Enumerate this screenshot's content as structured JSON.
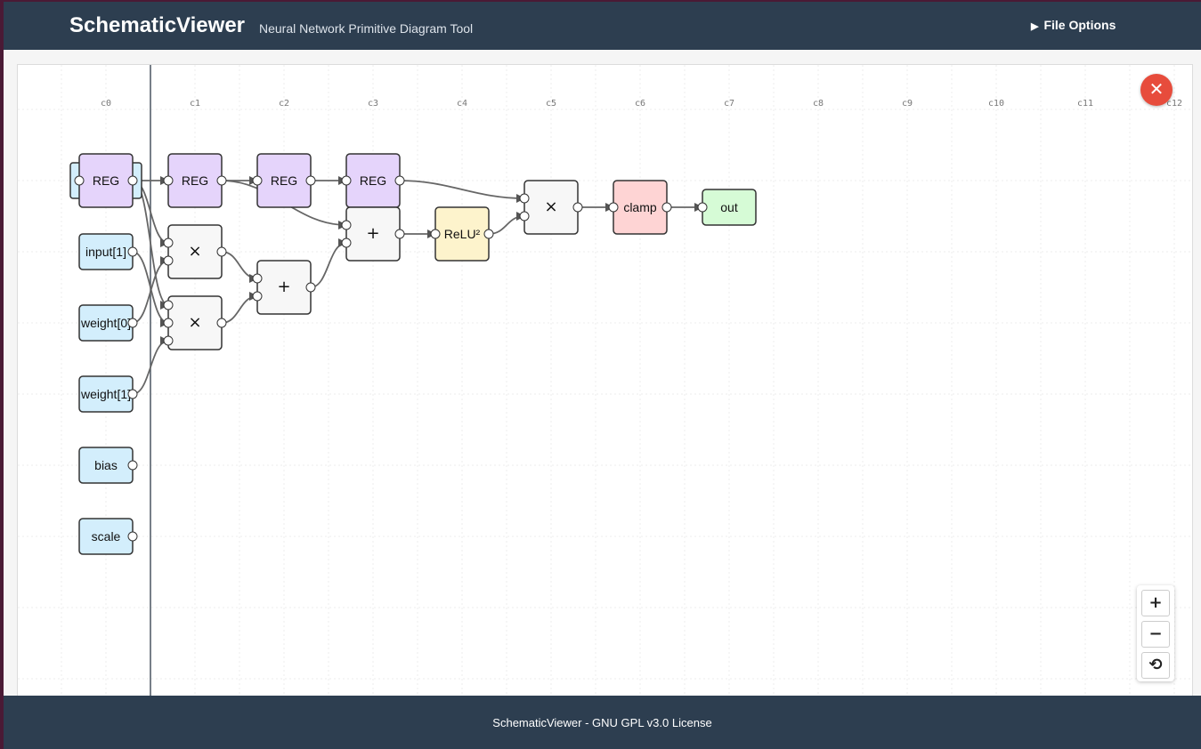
{
  "header": {
    "title": "SchematicViewer",
    "subtitle": "Neural Network Primitive Diagram Tool",
    "file_options_label": "File Options",
    "file_options_icon": "triangle-right-icon"
  },
  "canvas": {
    "column_labels": [
      "c0",
      "c1",
      "c2",
      "c3",
      "c4",
      "c5",
      "c6",
      "c7",
      "c8",
      "c9",
      "c10",
      "c11",
      "c12"
    ],
    "nodes": [
      {
        "id": "reg0",
        "label": "REG",
        "kind": "register",
        "col": 0,
        "row": 0
      },
      {
        "id": "input1",
        "label": "input[1]",
        "kind": "input",
        "col": 0,
        "row": 1
      },
      {
        "id": "weight0",
        "label": "weight[0]",
        "kind": "input",
        "col": 0,
        "row": 2
      },
      {
        "id": "weight1",
        "label": "weight[1]",
        "kind": "input",
        "col": 0,
        "row": 3
      },
      {
        "id": "bias",
        "label": "bias",
        "kind": "input",
        "col": 0,
        "row": 4
      },
      {
        "id": "scale",
        "label": "scale",
        "kind": "input",
        "col": 0,
        "row": 5
      },
      {
        "id": "reg1",
        "label": "REG",
        "kind": "register",
        "col": 1,
        "row": 0
      },
      {
        "id": "mul1",
        "label": "×",
        "kind": "op",
        "col": 1,
        "row": 1
      },
      {
        "id": "mul2",
        "label": "×",
        "kind": "op",
        "col": 1,
        "row": 2
      },
      {
        "id": "reg2",
        "label": "REG",
        "kind": "register",
        "col": 2,
        "row": 0
      },
      {
        "id": "add1",
        "label": "+",
        "kind": "op",
        "col": 2,
        "row": 1.5
      },
      {
        "id": "reg3",
        "label": "REG",
        "kind": "register",
        "col": 3,
        "row": 0
      },
      {
        "id": "add2",
        "label": "+",
        "kind": "op",
        "col": 3,
        "row": 0.75
      },
      {
        "id": "relu",
        "label": "ReLU²",
        "kind": "activation",
        "col": 4,
        "row": 0.75
      },
      {
        "id": "mul3",
        "label": "×",
        "kind": "op",
        "col": 5,
        "row": 0.375
      },
      {
        "id": "clamp",
        "label": "clamp",
        "kind": "clamp",
        "col": 6,
        "row": 0.375
      },
      {
        "id": "out",
        "label": "out",
        "kind": "output",
        "col": 7,
        "row": 0.375
      }
    ],
    "edges": [
      {
        "from": "reg0",
        "to": "reg1"
      },
      {
        "from": "reg0",
        "to": "mul1"
      },
      {
        "from": "reg0",
        "to": "mul2"
      },
      {
        "from": "input1",
        "to": "mul2"
      },
      {
        "from": "weight0",
        "to": "mul1"
      },
      {
        "from": "weight1",
        "to": "mul2"
      },
      {
        "from": "reg1",
        "to": "reg2"
      },
      {
        "from": "reg1",
        "to": "add2"
      },
      {
        "from": "mul1",
        "to": "add1"
      },
      {
        "from": "mul2",
        "to": "add1"
      },
      {
        "from": "reg2",
        "to": "reg3"
      },
      {
        "from": "add1",
        "to": "add2"
      },
      {
        "from": "reg3",
        "to": "mul3"
      },
      {
        "from": "add2",
        "to": "relu"
      },
      {
        "from": "relu",
        "to": "mul3"
      },
      {
        "from": "mul3",
        "to": "clamp"
      },
      {
        "from": "clamp",
        "to": "out"
      }
    ],
    "colors": {
      "input": "#d3eefc",
      "register": "#e5d4fb",
      "op": "#f7f7f7",
      "activation": "#fdf3cc",
      "clamp": "#fed4d4",
      "output": "#d6fbd6"
    }
  },
  "controls": {
    "close_icon": "close-icon",
    "close_label": "✕",
    "zoom_in_label": "+",
    "zoom_out_label": "−",
    "reset_label": "⟲"
  },
  "footer": {
    "text": "SchematicViewer - GNU GPL v3.0 License"
  },
  "theme": {
    "header_bg": "#2d3e50",
    "close_bg": "#e74c3c"
  }
}
